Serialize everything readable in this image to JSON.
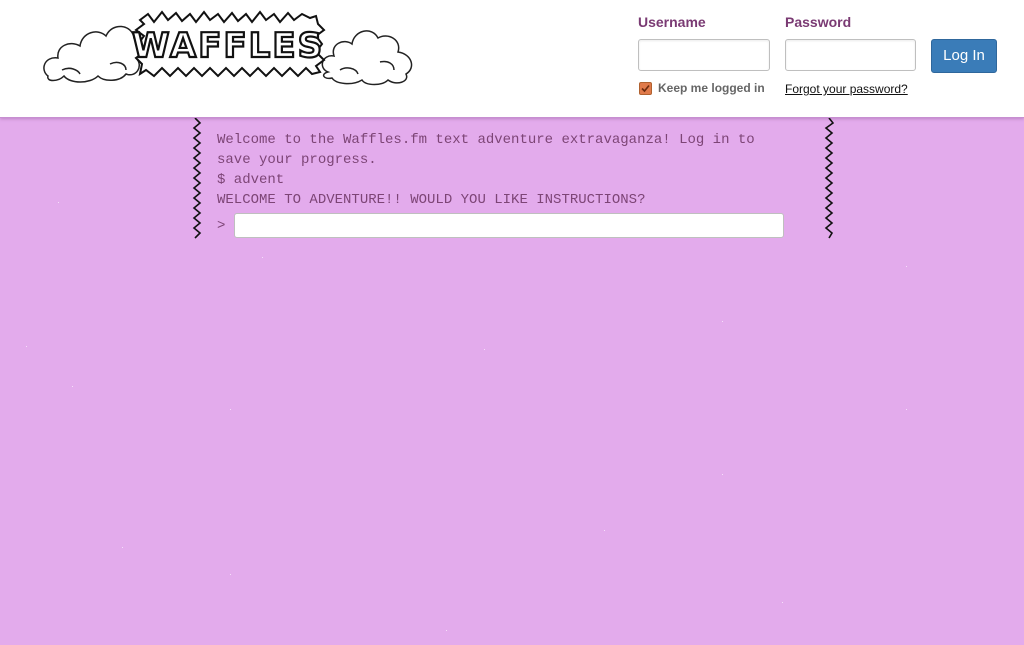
{
  "logo": {
    "text": "WAFFLES"
  },
  "login": {
    "username_label": "Username",
    "password_label": "Password",
    "button_label": "Log In",
    "remember_label": "Keep me logged in",
    "remember_checked": true,
    "forgot_label": "Forgot your password?"
  },
  "terminal": {
    "lines": [
      "Welcome to the Waffles.fm text adventure extravaganza! Log in to save your progress.",
      "$ advent",
      "WELCOME TO ADVENTURE!! WOULD YOU LIKE INSTRUCTIONS?"
    ],
    "prompt": ">"
  },
  "colors": {
    "background": "#e3abec",
    "terminal_text": "#7d4576",
    "label": "#7a3a73",
    "button": "#3a7cb8"
  }
}
